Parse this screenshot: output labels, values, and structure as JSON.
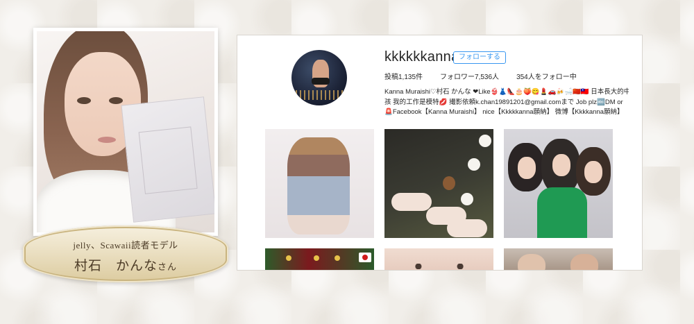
{
  "profile_card": {
    "caption_line1": "jelly、Scawaii読者モデル",
    "name": "村石　かんな",
    "honorific": "さん"
  },
  "instagram": {
    "username": "kkkkkkanna",
    "follow_label": "フォローする",
    "stats": {
      "posts": "投稿1,135件",
      "followers": "フォロワー7,536人",
      "following": "354人をフォロー中"
    },
    "bio": [
      "Kanna Muraishi♡村石 かんな ❤Like👙👗👠🎂🍑😋💄🚗🍻🛁🇨🇳🇹🇼 日本長大的中國女",
      "孩 我的工作是模特💋 撮影依頼k.chan19891201@gmail.comまで Job plz🔤DM or",
      "🚨Facebook【Kanna Muraishi】 nice【Kkkkkanna願納】 微博【Kkkkanna願納】"
    ],
    "accent_color": "#3897f0"
  }
}
